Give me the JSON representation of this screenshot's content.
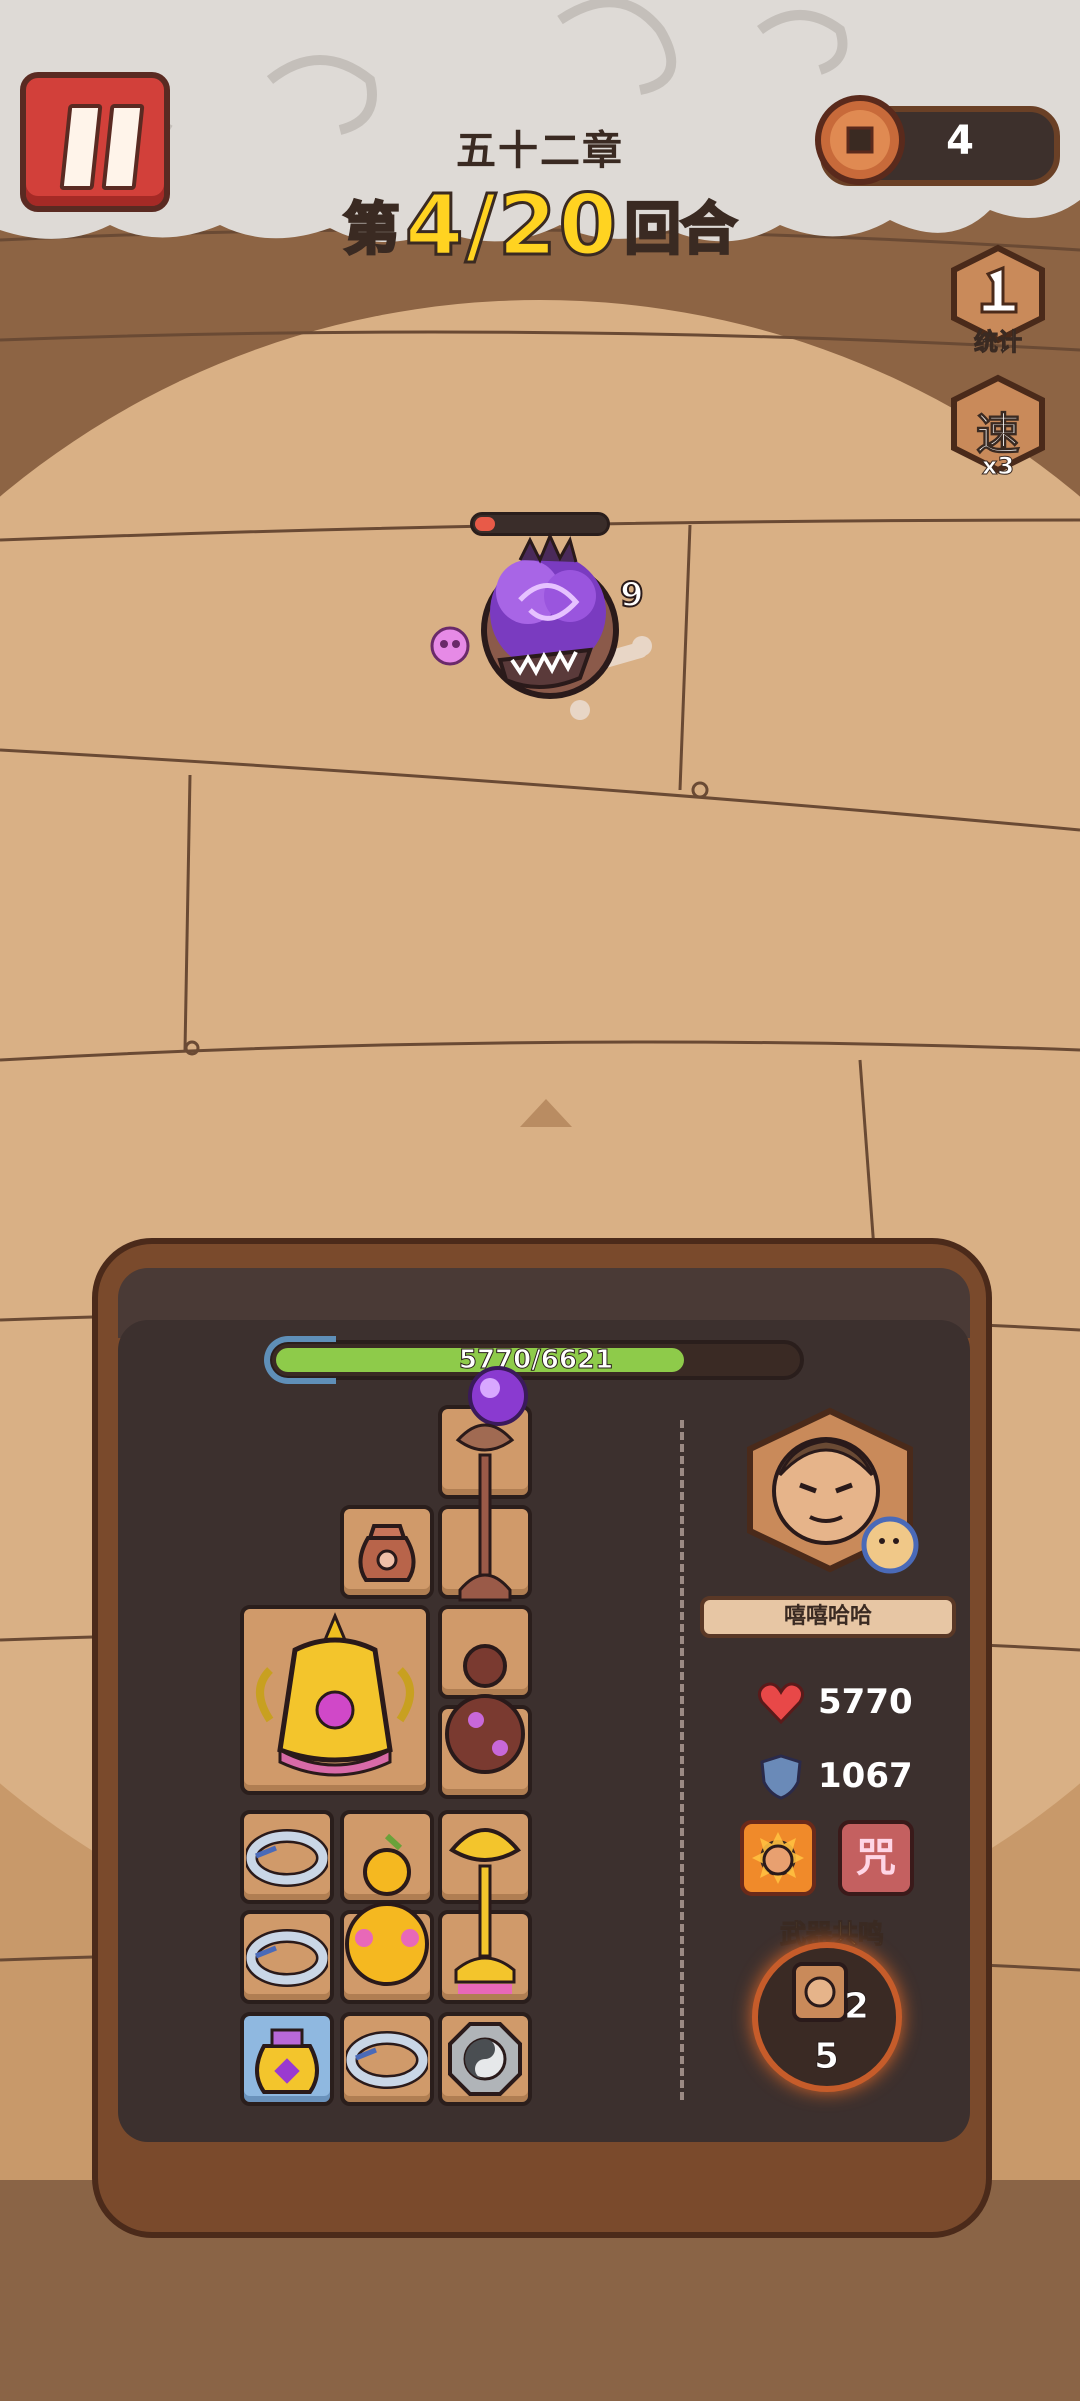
{
  "header": {
    "chapter": "五十二章",
    "round_prefix": "第",
    "round_value": "4/20",
    "round_suffix": "回合",
    "coins": "4"
  },
  "side_buttons": {
    "stats_label": "统计",
    "speed_glyph": "速",
    "speed_label": "x3"
  },
  "enemy": {
    "number": "9",
    "hp_fraction": 0.1
  },
  "player": {
    "hp_text": "5770/6621",
    "hp_current": 5770,
    "hp_max": 6621,
    "name": "嘻嘻哈哈",
    "health": "5770",
    "armor": "1067",
    "curse_glyph": "咒"
  },
  "resonance": {
    "label": "武器共鸣",
    "count_a": "2",
    "count_b": "5"
  },
  "icons": {
    "pause": "pause-icon",
    "coin": "coin-icon",
    "stats": "stats-icon",
    "speed": "speed-icon",
    "heart": "heart-icon",
    "shield": "shield-icon"
  },
  "colors": {
    "hp_green": "#8ecb4a",
    "round_yellow": "#ffd321",
    "pause_red": "#d2403a"
  }
}
